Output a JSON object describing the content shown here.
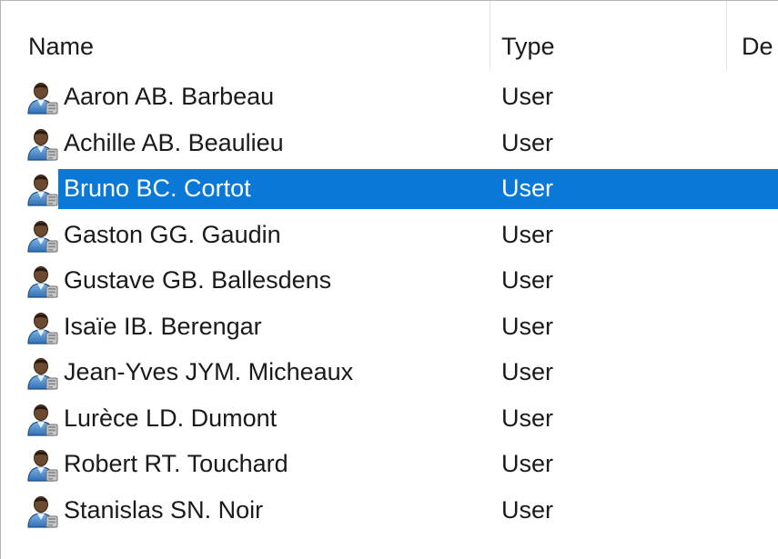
{
  "columns": {
    "name": "Name",
    "type": "Type",
    "description": "De"
  },
  "icon": "user-icon",
  "colors": {
    "selection": "#0a78d7",
    "text": "#1a1a1a",
    "selected_text": "#ffffff"
  },
  "rows": [
    {
      "name": "Aaron AB. Barbeau",
      "type": "User",
      "selected": false
    },
    {
      "name": "Achille AB. Beaulieu",
      "type": "User",
      "selected": false
    },
    {
      "name": "Bruno BC. Cortot",
      "type": "User",
      "selected": true
    },
    {
      "name": "Gaston GG. Gaudin",
      "type": "User",
      "selected": false
    },
    {
      "name": "Gustave GB. Ballesdens",
      "type": "User",
      "selected": false
    },
    {
      "name": "Isaïe IB. Berengar",
      "type": "User",
      "selected": false
    },
    {
      "name": "Jean-Yves JYM. Micheaux",
      "type": "User",
      "selected": false
    },
    {
      "name": "Lurèce LD. Dumont",
      "type": "User",
      "selected": false
    },
    {
      "name": "Robert RT. Touchard",
      "type": "User",
      "selected": false
    },
    {
      "name": "Stanislas SN. Noir",
      "type": "User",
      "selected": false
    }
  ]
}
